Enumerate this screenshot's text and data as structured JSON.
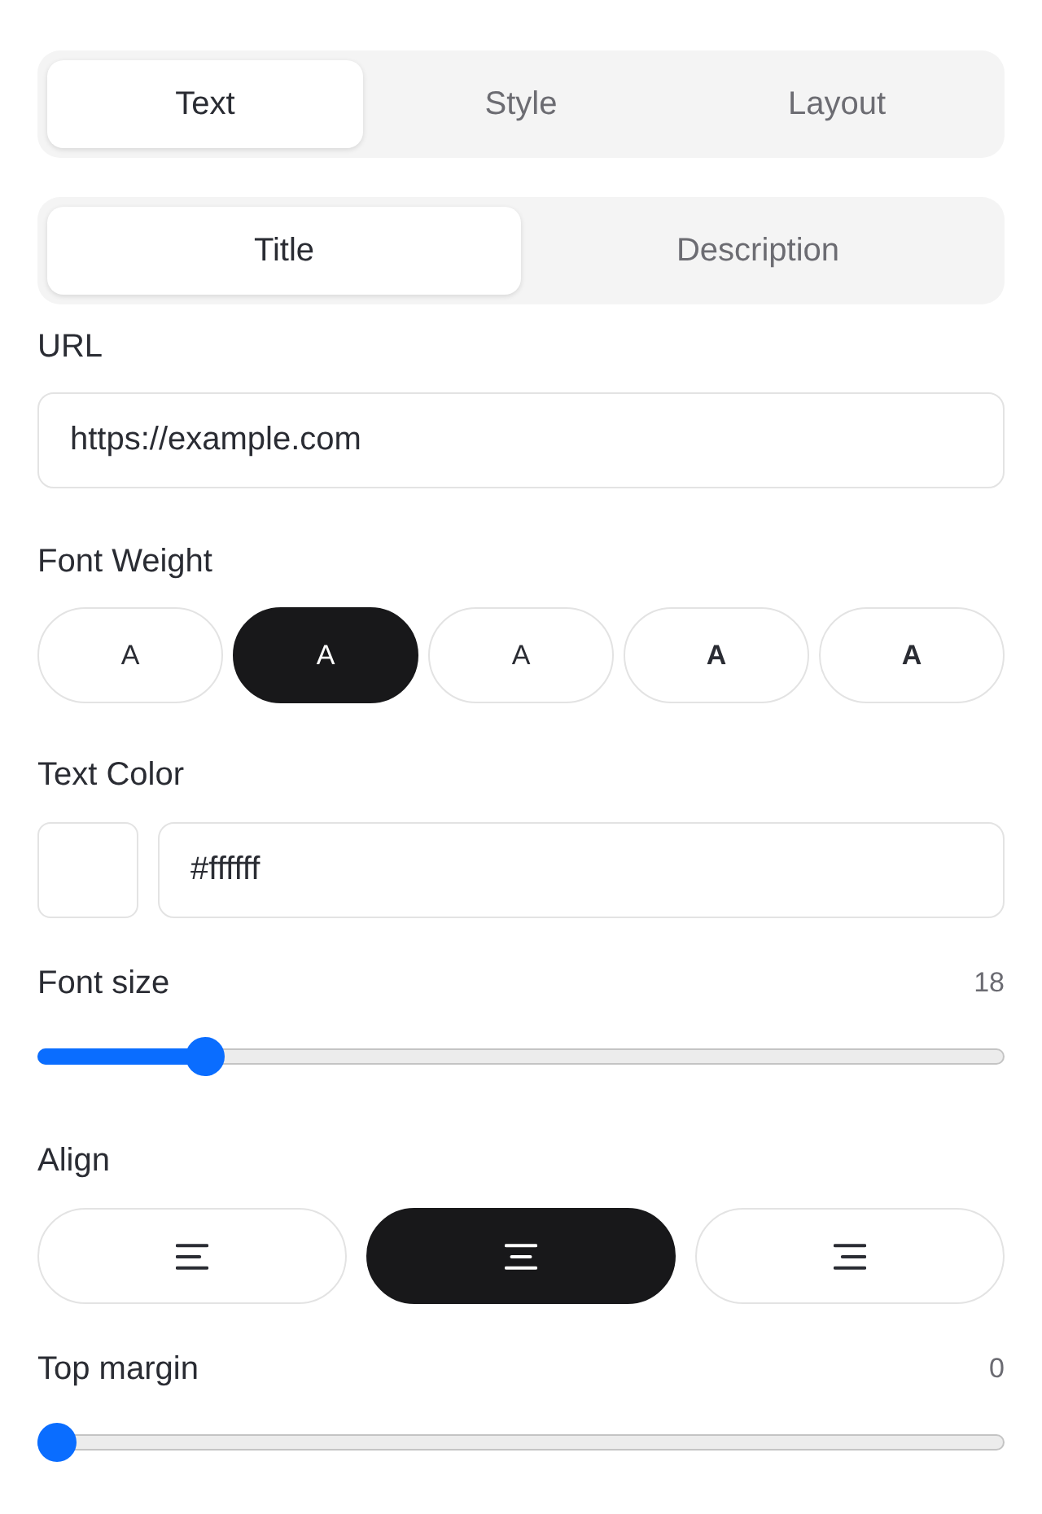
{
  "tabs": [
    {
      "label": "Text",
      "selected": true
    },
    {
      "label": "Style",
      "selected": false
    },
    {
      "label": "Layout",
      "selected": false
    }
  ],
  "subtabs": [
    {
      "label": "Title",
      "selected": true
    },
    {
      "label": "Description",
      "selected": false
    }
  ],
  "url": {
    "label": "URL",
    "value": "https://example.com"
  },
  "font_weight": {
    "label": "Font Weight",
    "options": [
      {
        "label": "A",
        "kind": "light",
        "selected": false
      },
      {
        "label": "A",
        "kind": "regular",
        "selected": true
      },
      {
        "label": "A",
        "kind": "medium",
        "selected": false
      },
      {
        "label": "A",
        "kind": "semibold",
        "selected": false
      },
      {
        "label": "A",
        "kind": "bold",
        "selected": false
      }
    ]
  },
  "text_color": {
    "label": "Text Color",
    "color": "#ffffff",
    "value": "#ffffff"
  },
  "font_size": {
    "label": "Font size",
    "value": "18",
    "level": 0.16
  },
  "align": {
    "label": "Align",
    "options": [
      {
        "kind": "left",
        "selected": false
      },
      {
        "kind": "center",
        "selected": true
      },
      {
        "kind": "right",
        "selected": false
      }
    ]
  },
  "top_margin": {
    "label": "Top margin",
    "value": "0",
    "level": 0
  }
}
